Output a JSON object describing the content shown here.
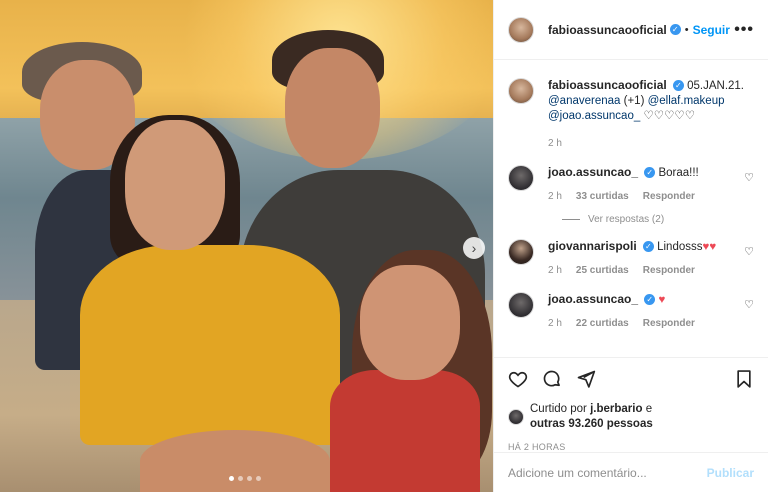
{
  "post": {
    "author": "fabioassuncaooficial",
    "follow_separator": "•",
    "follow_label": "Seguir",
    "more_label": "•••",
    "carousel_next": "›",
    "caption": {
      "username": "fabioassuncaooficial",
      "date": "05.JAN.21.",
      "mention1": "@anaverenaa",
      "extra": "(+1)",
      "mention2": "@ellaf.makeup",
      "mention3": "@joao.assuncao_",
      "hearts": "♡♡♡♡♡",
      "time": "2 h"
    },
    "comments": [
      {
        "username": "joao.assuncao_",
        "text": "Boraa!!!",
        "time": "2 h",
        "likes": "33 curtidas",
        "reply": "Responder",
        "view_replies": "Ver respostas (2)"
      },
      {
        "username": "giovannarispoli",
        "text": "Lindosss",
        "hearts": "♥♥",
        "time": "2 h",
        "likes": "25 curtidas",
        "reply": "Responder"
      },
      {
        "username": "joao.assuncao_",
        "text": "",
        "hearts": "♥",
        "time": "2 h",
        "likes": "22 curtidas",
        "reply": "Responder"
      }
    ],
    "liked_by": {
      "prefix": "Curtido por",
      "user": "j.berbario",
      "and": "e",
      "others": "outras 93.260 pessoas"
    },
    "posted_ago": "HÁ 2 HORAS",
    "add_comment_placeholder": "Adicione um comentário...",
    "post_button": "Publicar",
    "carousel": {
      "slides": 4,
      "active": 0
    }
  },
  "colors": {
    "verified": "#3897f0",
    "link": "#0095f6",
    "mention": "#00376b",
    "heart_red": "#ed4956",
    "muted": "#8e8e8e"
  }
}
